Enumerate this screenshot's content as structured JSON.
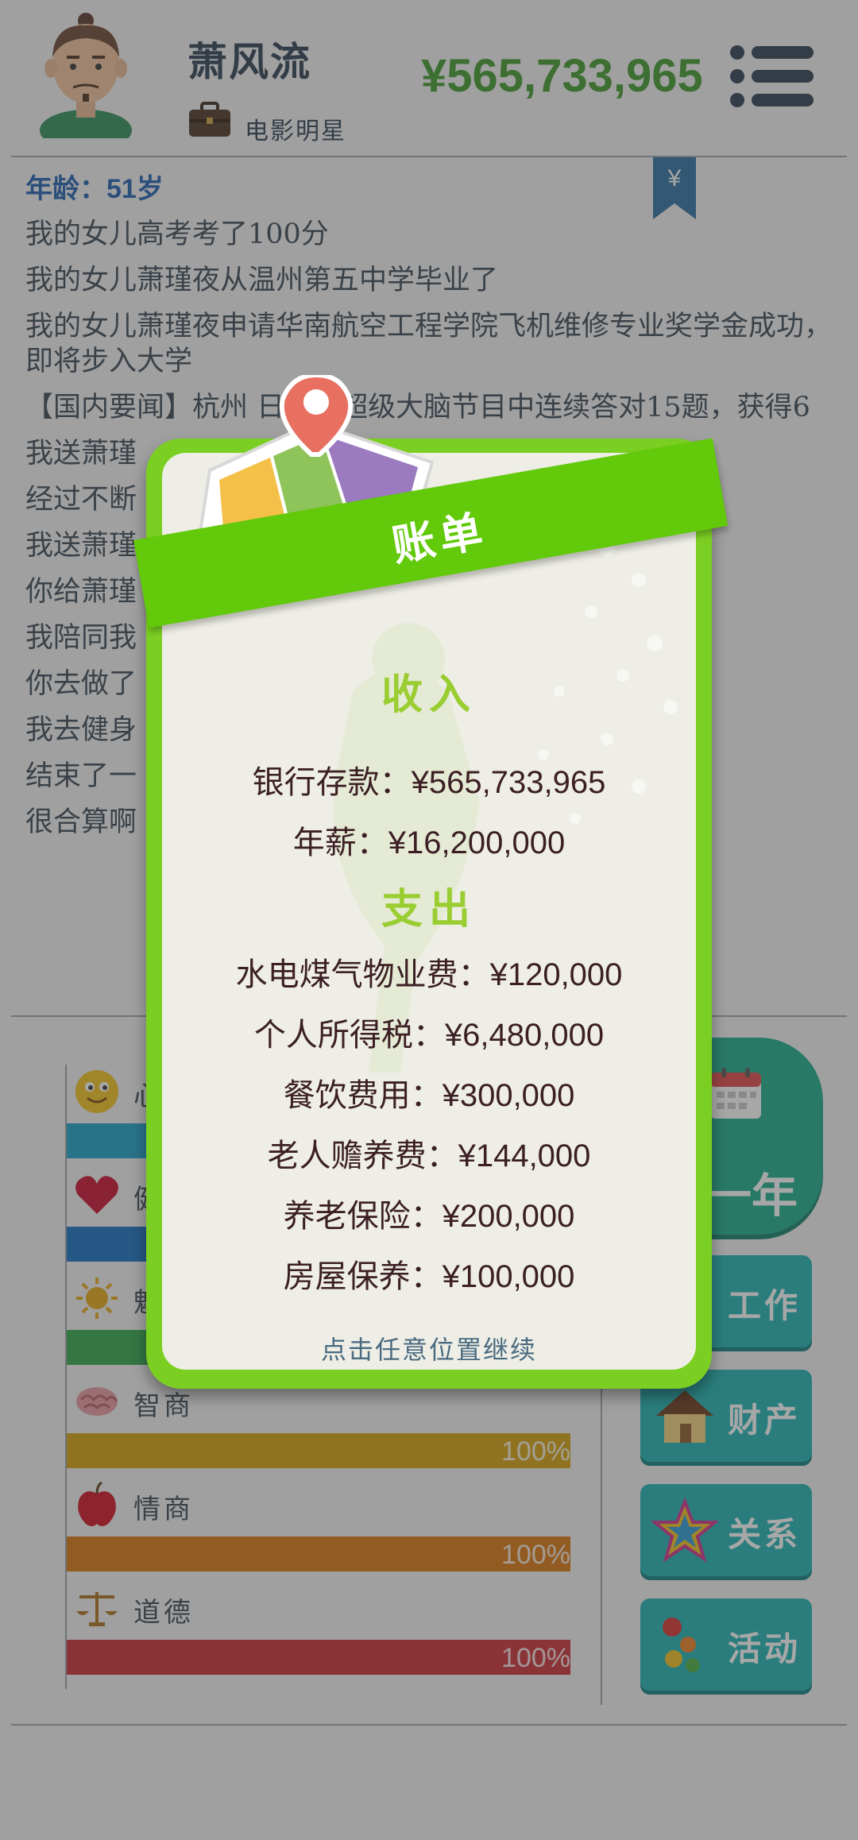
{
  "player": {
    "name": "萧风流",
    "job": "电影明星",
    "money": "¥565,733,965",
    "age_text": "年龄：51岁"
  },
  "log": [
    "我的女儿高考考了100分",
    "我的女儿萧瑾夜从温州第五中学毕业了",
    "我的女儿萧瑾夜申请华南航空工程学院飞机维修专业奖学金成功，即将步入大学",
    "【国内要闻】杭州 日前在超级大脑节目中连续答对15题，获得6",
    "我送萧瑾",
    "经过不断",
    "我送萧瑾",
    "你给萧瑾                                      ，萧瑾夜学会了游",
    "我陪同我                                      ，关系更亲近了",
    "你去做了",
    "我去健身",
    "结束了一                                      不要办一张年卡，",
    "很合算啊"
  ],
  "stats": [
    {
      "label": "心",
      "value": 100,
      "display": "",
      "color": "#1aa0c8",
      "icon": "smiley-icon"
    },
    {
      "label": "健",
      "value": 100,
      "display": "",
      "color": "#1470c2",
      "icon": "heart-icon"
    },
    {
      "label": "魅",
      "value": 100,
      "display": "",
      "color": "#2fa84a",
      "icon": "sun-icon"
    },
    {
      "label": "智商",
      "value": 100,
      "display": "100%",
      "color": "#d4a10c",
      "icon": "brain-icon"
    },
    {
      "label": "情商",
      "value": 100,
      "display": "100%",
      "color": "#d8760c",
      "icon": "apple-icon"
    },
    {
      "label": "道德",
      "value": 100,
      "display": "100%",
      "color": "#cc2f36",
      "icon": "scales-icon"
    }
  ],
  "side": {
    "year_label": "一年",
    "buttons": [
      "工作",
      "财产",
      "关系",
      "活动"
    ]
  },
  "bill": {
    "title": "账单",
    "income_title": "收入",
    "income": [
      {
        "label": "银行存款：",
        "value": "¥565,733,965"
      },
      {
        "label": "年薪：",
        "value": "¥16,200,000"
      }
    ],
    "expense_title": "支出",
    "expense": [
      {
        "label": "水电煤气物业费：",
        "value": "¥120,000"
      },
      {
        "label": "个人所得税：",
        "value": "¥6,480,000"
      },
      {
        "label": "餐饮费用：",
        "value": "¥300,000"
      },
      {
        "label": "老人赡养费：",
        "value": "¥144,000"
      },
      {
        "label": "养老保险：",
        "value": "¥200,000"
      },
      {
        "label": "房屋保养：",
        "value": "¥100,000"
      }
    ],
    "continue_hint": "点击任意位置继续"
  }
}
